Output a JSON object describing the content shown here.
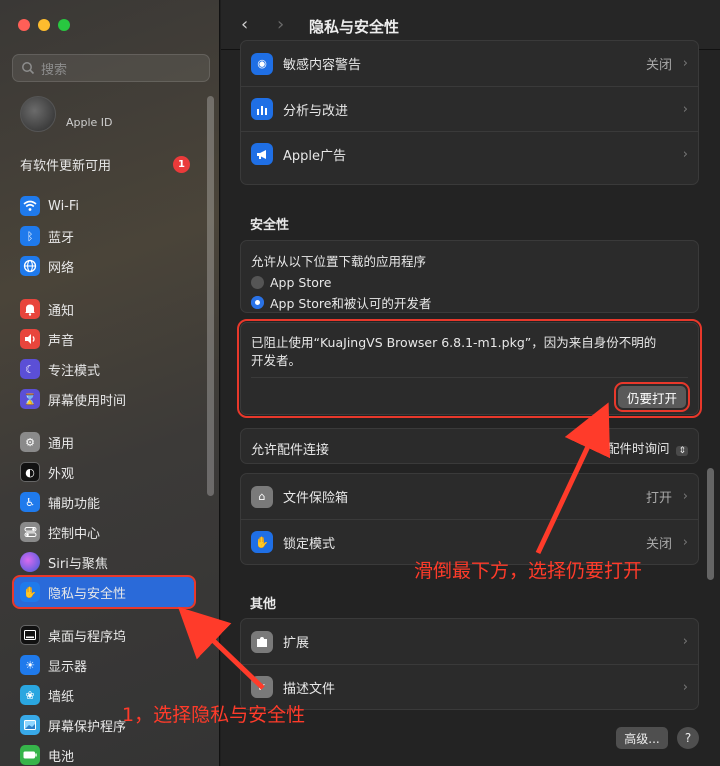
{
  "sidebar": {
    "search_placeholder": "搜索",
    "apple_id": "Apple ID",
    "update_text": "有软件更新可用",
    "update_badge": "1",
    "items": [
      {
        "label": "Wi-Fi",
        "icon": "wifi-icon",
        "color": "#1f7aec"
      },
      {
        "label": "蓝牙",
        "icon": "bluetooth-icon",
        "color": "#1f7aec"
      },
      {
        "label": "网络",
        "icon": "globe-icon",
        "color": "#1f7aec"
      },
      {
        "label": "通知",
        "icon": "bell-icon",
        "color": "#e8453c"
      },
      {
        "label": "声音",
        "icon": "speaker-icon",
        "color": "#e8453c"
      },
      {
        "label": "专注模式",
        "icon": "moon-icon",
        "color": "#5b4fd6"
      },
      {
        "label": "屏幕使用时间",
        "icon": "hourglass-icon",
        "color": "#5b4fd6"
      },
      {
        "label": "通用",
        "icon": "gear-icon",
        "color": "#8a8a8a"
      },
      {
        "label": "外观",
        "icon": "appearance-icon",
        "color": "#111111"
      },
      {
        "label": "辅助功能",
        "icon": "accessibility-icon",
        "color": "#1f7aec"
      },
      {
        "label": "控制中心",
        "icon": "switches-icon",
        "color": "#8a8a8a"
      },
      {
        "label": "Siri与聚焦",
        "icon": "siri-icon",
        "color": "#7a4fe0"
      },
      {
        "label": "隐私与安全性",
        "icon": "hand-icon",
        "color": "#1f7aec"
      },
      {
        "label": "桌面与程序坞",
        "icon": "dock-icon",
        "color": "#111111"
      },
      {
        "label": "显示器",
        "icon": "sun-icon",
        "color": "#1f7aec"
      },
      {
        "label": "墙纸",
        "icon": "flower-icon",
        "color": "#2aa6e0"
      },
      {
        "label": "屏幕保护程序",
        "icon": "screensaver-icon",
        "color": "#38a9e8"
      },
      {
        "label": "电池",
        "icon": "battery-icon",
        "color": "#36b44a"
      }
    ]
  },
  "titlebar": {
    "title": "隐私与安全性",
    "back": "‹",
    "forward": "›"
  },
  "privacy_rows": [
    {
      "label": "敏感内容警告",
      "value": "关闭"
    },
    {
      "label": "分析与改进",
      "value": ""
    },
    {
      "label": "Apple广告",
      "value": ""
    }
  ],
  "security": {
    "section_title": "安全性",
    "allow_title": "允许从以下位置下载的应用程序",
    "options": [
      "App Store",
      "App Store和被认可的开发者"
    ],
    "selected_index": 1,
    "blocked_message": "已阻止使用“KuaJingVS Browser 6.8.1-m1.pkg”，因为来自身份不明的开发者。",
    "open_anyway": "仍要打开",
    "accessory_label": "允许配件连接",
    "accessory_value": "配件时询问",
    "rows": [
      {
        "label": "文件保险箱",
        "value": "打开"
      },
      {
        "label": "锁定模式",
        "value": "关闭"
      }
    ]
  },
  "other": {
    "section_title": "其他",
    "rows": [
      {
        "label": "扩展"
      },
      {
        "label": "描述文件"
      }
    ]
  },
  "footer": {
    "advanced": "高级...",
    "help": "?"
  },
  "annotations": {
    "step1": "1，选择隐私与安全性",
    "step2": "滑倒最下方，选择仍要打开",
    "color": "#ff3b2a"
  }
}
